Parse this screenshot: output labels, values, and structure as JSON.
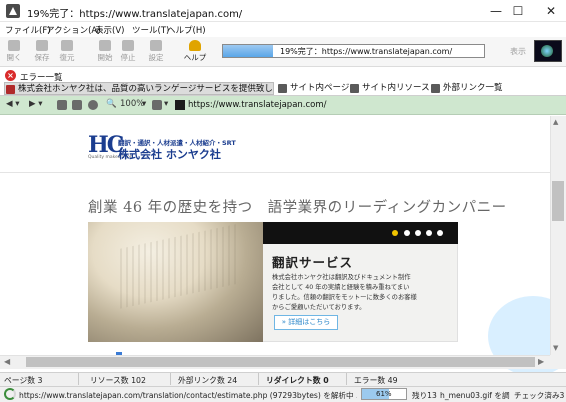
{
  "window": {
    "title": "19%完了：https://www.translatejapan.com/",
    "minimize": "—",
    "maximize": "☐",
    "close": "✕"
  },
  "menu": [
    "ファイル(F)",
    "アクション(A)",
    "表示(V)",
    "ツール(T)",
    "ヘルプ(H)"
  ],
  "toolbar": {
    "buttons": [
      {
        "label": "開く",
        "icon": "folder-icon"
      },
      {
        "label": "保存",
        "icon": "save-icon"
      },
      {
        "label": "復元",
        "icon": "restore-icon"
      },
      {
        "label": "開始",
        "icon": "start-icon"
      },
      {
        "label": "停止",
        "icon": "stop-icon"
      },
      {
        "label": "設定",
        "icon": "settings-icon"
      },
      {
        "label": "ヘルプ",
        "icon": "help-icon"
      }
    ],
    "progress_text": "19%完了：https://www.translatejapan.com/",
    "progress_fraction": 0.19,
    "display_label": "表示"
  },
  "errors": {
    "label": "エラー一覧"
  },
  "tabs": [
    {
      "label": "株式会社ホンヤク社は、品質の高いランゲージサービスを提供致します。"
    },
    {
      "label": "サイト内ページ"
    },
    {
      "label": "サイト内リソース"
    },
    {
      "label": "外部リンク一覧"
    }
  ],
  "browser": {
    "zoom": "100%",
    "url": "https://www.translatejapan.com/"
  },
  "page": {
    "logo_mark": "HC",
    "logo_tagline": "Quality makes a job",
    "logo_sub": "翻訳・通訳・人材派遣・人材紹介・SRT",
    "logo_name": "株式会社 ホンヤク社",
    "headline": "創業 46 年の歴史を持つ　語学業界のリーディングカンパニー",
    "hero_title": "翻訳サービス",
    "hero_lines": [
      "株式会社ホンヤク社は翻訳及びドキュメント制作",
      "会社として 40 年の実績と経験を積み重ねてまい",
      "りました。信頼の翻訳をモットーに数多くのお客様",
      "からご愛顧いただいております。"
    ],
    "details_button": "» 詳細はこちら"
  },
  "status": {
    "pages": "ページ数 3",
    "resources": "リソース数 102",
    "external_links": "外部リンク数 24",
    "redirects": "リダイレクト数 0",
    "errors": "エラー数 49",
    "analyzing": "https://www.translatejapan.com/translation/contact/estimate.php (97293bytes) を解析中 ...",
    "progress": "61%",
    "progress_fraction": 0.61,
    "remaining": "残り13",
    "current": "h_menu03.gif を調べています ...",
    "checked": "チェック済み3"
  }
}
